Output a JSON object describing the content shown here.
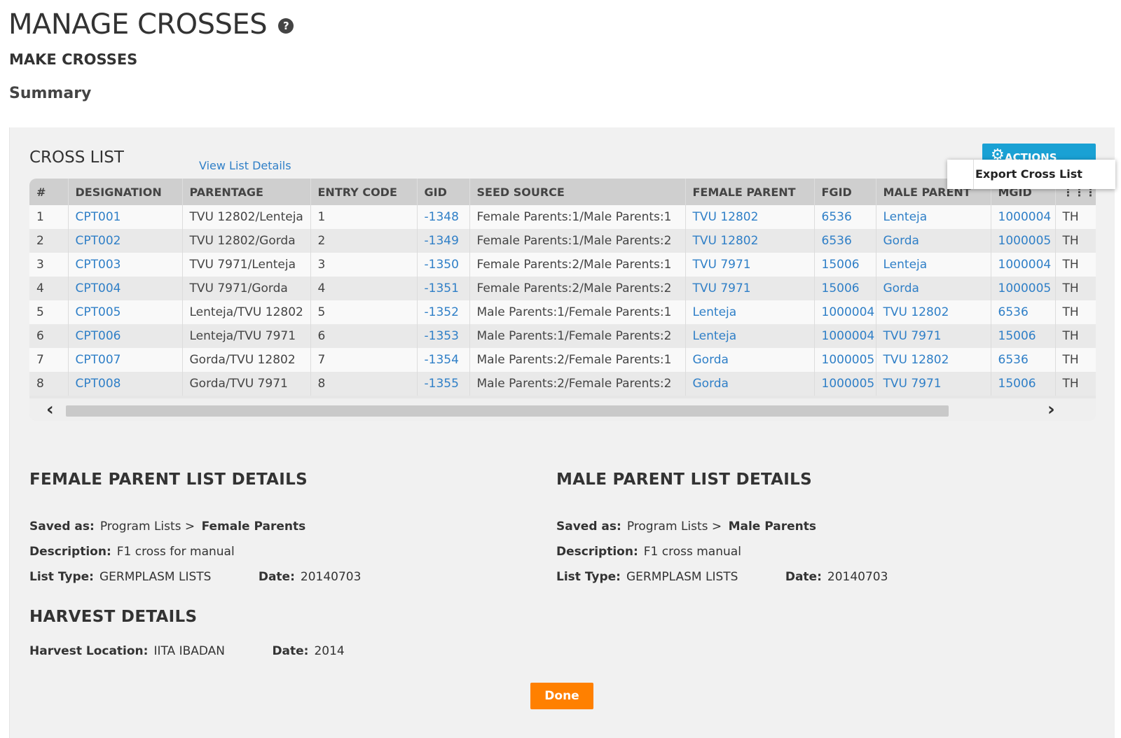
{
  "page": {
    "title": "MANAGE CROSSES",
    "help_icon": "?",
    "subtitle": "MAKE CROSSES",
    "section": "Summary"
  },
  "cross_list": {
    "title": "CROSS LIST",
    "view_link": "View List Details",
    "actions_label": "ACTIONS",
    "actions_icon": "gear-icon",
    "menu_items": [
      "Export Cross List"
    ],
    "columns": [
      "#",
      "DESIGNATION",
      "PARENTAGE",
      "ENTRY CODE",
      "GID",
      "SEED SOURCE",
      "FEMALE PARENT",
      "FGID",
      "MALE PARENT",
      "MGID",
      ""
    ],
    "rows": [
      [
        "1",
        "CPT001",
        "TVU 12802/Lenteja",
        "1",
        "-1348",
        "Female Parents:1/Male Parents:1",
        "TVU 12802",
        "6536",
        "Lenteja",
        "1000004",
        "TH"
      ],
      [
        "2",
        "CPT002",
        "TVU 12802/Gorda",
        "2",
        "-1349",
        "Female Parents:1/Male Parents:2",
        "TVU 12802",
        "6536",
        "Gorda",
        "1000005",
        "TH"
      ],
      [
        "3",
        "CPT003",
        "TVU 7971/Lenteja",
        "3",
        "-1350",
        "Female Parents:2/Male Parents:1",
        "TVU 7971",
        "15006",
        "Lenteja",
        "1000004",
        "TH"
      ],
      [
        "4",
        "CPT004",
        "TVU 7971/Gorda",
        "4",
        "-1351",
        "Female Parents:2/Male Parents:2",
        "TVU 7971",
        "15006",
        "Gorda",
        "1000005",
        "TH"
      ],
      [
        "5",
        "CPT005",
        "Lenteja/TVU 12802",
        "5",
        "-1352",
        "Male Parents:1/Female Parents:1",
        "Lenteja",
        "1000004",
        "TVU 12802",
        "6536",
        "TH"
      ],
      [
        "6",
        "CPT006",
        "Lenteja/TVU 7971",
        "6",
        "-1353",
        "Male Parents:1/Female Parents:2",
        "Lenteja",
        "1000004",
        "TVU 7971",
        "15006",
        "TH"
      ],
      [
        "7",
        "CPT007",
        "Gorda/TVU 12802",
        "7",
        "-1354",
        "Male Parents:2/Female Parents:1",
        "Gorda",
        "1000005",
        "TVU 12802",
        "6536",
        "TH"
      ],
      [
        "8",
        "CPT008",
        "Gorda/TVU 7971",
        "8",
        "-1355",
        "Male Parents:2/Female Parents:2",
        "Gorda",
        "1000005",
        "TVU 7971",
        "15006",
        "TH"
      ]
    ],
    "link_columns": [
      1,
      4,
      6,
      7,
      8,
      9
    ],
    "scroll_left": "‹",
    "scroll_right": "›",
    "column_picker_icon": "⋮⋮⋮"
  },
  "female_details": {
    "title": "FEMALE PARENT LIST DETAILS",
    "saved_as_label": "Saved as:",
    "saved_as_path": "Program Lists >",
    "saved_as_name": "Female Parents",
    "description_label": "Description:",
    "description": "F1 cross for manual",
    "list_type_label": "List Type:",
    "list_type": "GERMPLASM LISTS",
    "date_label": "Date:",
    "date": "20140703"
  },
  "male_details": {
    "title": "MALE PARENT LIST DETAILS",
    "saved_as_label": "Saved as:",
    "saved_as_path": "Program Lists >",
    "saved_as_name": "Male Parents",
    "description_label": "Description:",
    "description": "F1 cross manual",
    "list_type_label": "List Type:",
    "list_type": "GERMPLASM LISTS",
    "date_label": "Date:",
    "date": "20140703"
  },
  "harvest": {
    "title": "HARVEST DETAILS",
    "location_label": "Harvest Location:",
    "location": "IITA IBADAN",
    "date_label": "Date:",
    "date": "2014"
  },
  "done_label": "Done",
  "colors": {
    "link": "#2f7fc7",
    "actions_button": "#1aa1d4",
    "done_button": "#ff8000"
  }
}
